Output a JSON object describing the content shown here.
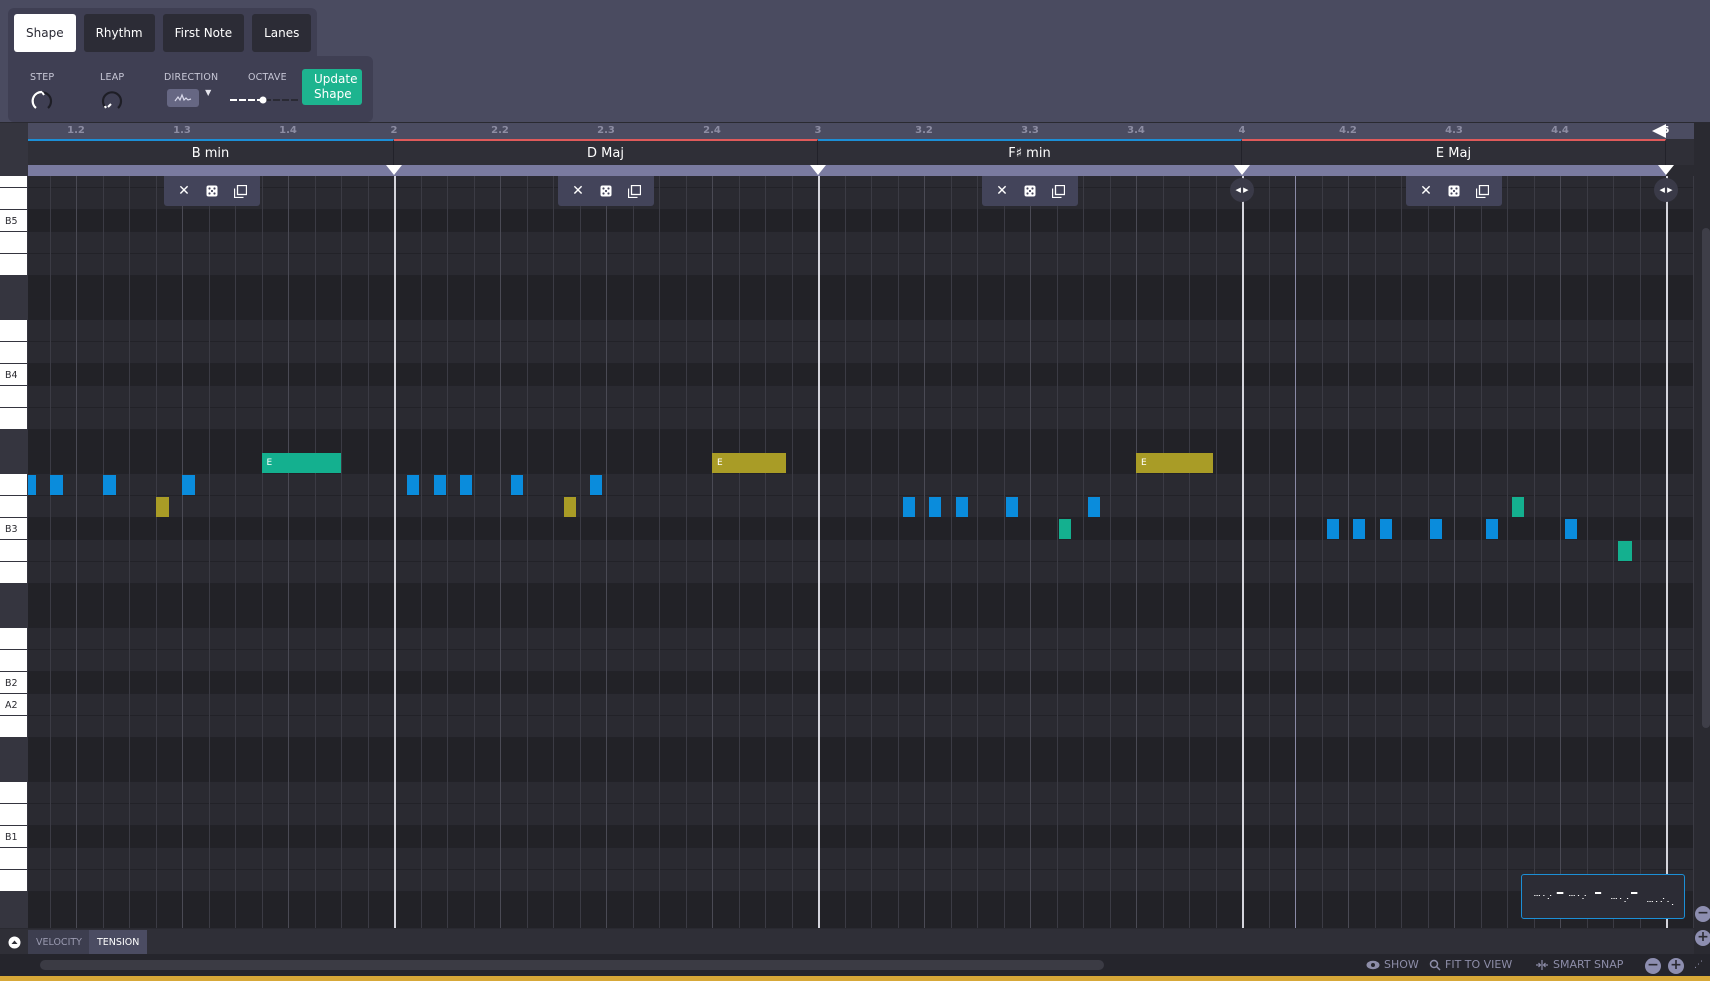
{
  "tabs": [
    {
      "label": "Shape",
      "active": true
    },
    {
      "label": "Rhythm",
      "active": false
    },
    {
      "label": "First Note",
      "active": false
    },
    {
      "label": "Lanes",
      "active": false
    }
  ],
  "controls": {
    "step_label": "STEP",
    "leap_label": "LEAP",
    "direction_label": "DIRECTION",
    "direction_icon": "zigzag-wave-icon",
    "octave_label": "OCTAVE",
    "octave_value_fraction": 0.55,
    "update_label_line1": "Update",
    "update_label_line2": "Shape"
  },
  "ruler": {
    "ticks": [
      "1.2",
      "1.3",
      "1.4",
      "2",
      "2.2",
      "2.3",
      "2.4",
      "3",
      "3.2",
      "3.3",
      "3.4",
      "4",
      "4.2",
      "4.3",
      "4.4",
      "5"
    ]
  },
  "chords": [
    {
      "name": "B min",
      "color": "#1c8fd6"
    },
    {
      "name": "D Maj",
      "color": "#e05a5a"
    },
    {
      "name": "F♯ min",
      "color": "#1c8fd6"
    },
    {
      "name": "E Maj",
      "color": "#e05a5a"
    }
  ],
  "chord_tools": {
    "remove_icon": "✕",
    "randomize_icon": "dice-icon",
    "duplicate_icon": "copy-icon"
  },
  "piano_keys": {
    "labels": {
      "B5": 2,
      "B4": 9,
      "B3": 16,
      "B2": 23,
      "A2": 24,
      "B1": 30
    }
  },
  "notes": [
    {
      "bar": 1,
      "start16": 1,
      "len16": 0.5,
      "row": 14,
      "color": "#0a8cdc"
    },
    {
      "bar": 1,
      "start16": 2,
      "len16": 0.5,
      "row": 14,
      "color": "#0a8cdc"
    },
    {
      "bar": 1,
      "start16": 3,
      "len16": 0.5,
      "row": 14,
      "color": "#0a8cdc"
    },
    {
      "bar": 1,
      "start16": 5,
      "len16": 0.5,
      "row": 14,
      "color": "#0a8cdc"
    },
    {
      "bar": 1,
      "start16": 7,
      "len16": 0.5,
      "row": 15,
      "color": "#a99c26"
    },
    {
      "bar": 1,
      "start16": 8,
      "len16": 0.5,
      "row": 14,
      "color": "#0a8cdc"
    },
    {
      "bar": 1,
      "start16": 11,
      "len16": 3,
      "row": 13,
      "color": "#14b08f",
      "label": "E"
    },
    {
      "bar": 2,
      "start16": 0.5,
      "len16": 0.3,
      "row": 14,
      "color": "#0a8cdc"
    },
    {
      "bar": 2,
      "start16": 1.5,
      "len16": 0.3,
      "row": 14,
      "color": "#0a8cdc"
    },
    {
      "bar": 2,
      "start16": 2.5,
      "len16": 0.3,
      "row": 14,
      "color": "#0a8cdc"
    },
    {
      "bar": 2,
      "start16": 4.4,
      "len16": 0.3,
      "row": 14,
      "color": "#0a8cdc"
    },
    {
      "bar": 2,
      "start16": 6.4,
      "len16": 0.3,
      "row": 15,
      "color": "#a99c26"
    },
    {
      "bar": 2,
      "start16": 7.4,
      "len16": 0.3,
      "row": 14,
      "color": "#0a8cdc"
    },
    {
      "bar": 2,
      "start16": 12,
      "len16": 2.8,
      "row": 13,
      "color": "#a99c26",
      "label": "E"
    },
    {
      "bar": 3,
      "start16": 3.2,
      "len16": 0.3,
      "row": 15,
      "color": "#0a8cdc"
    },
    {
      "bar": 3,
      "start16": 4.2,
      "len16": 0.3,
      "row": 15,
      "color": "#0a8cdc"
    },
    {
      "bar": 3,
      "start16": 5.2,
      "len16": 0.3,
      "row": 15,
      "color": "#0a8cdc"
    },
    {
      "bar": 3,
      "start16": 7.1,
      "len16": 0.3,
      "row": 15,
      "color": "#0a8cdc"
    },
    {
      "bar": 3,
      "start16": 9.1,
      "len16": 0.3,
      "row": 16,
      "color": "#14b08f"
    },
    {
      "bar": 3,
      "start16": 10.2,
      "len16": 0.3,
      "row": 15,
      "color": "#0a8cdc"
    },
    {
      "bar": 3,
      "start16": 12,
      "len16": 2.9,
      "row": 13,
      "color": "#a99c26",
      "label": "E"
    },
    {
      "bar": 4,
      "start16": 3.2,
      "len16": 0.3,
      "row": 16,
      "color": "#0a8cdc"
    },
    {
      "bar": 4,
      "start16": 4.2,
      "len16": 0.3,
      "row": 16,
      "color": "#0a8cdc"
    },
    {
      "bar": 4,
      "start16": 5.2,
      "len16": 0.3,
      "row": 16,
      "color": "#0a8cdc"
    },
    {
      "bar": 4,
      "start16": 7.1,
      "len16": 0.3,
      "row": 16,
      "color": "#0a8cdc"
    },
    {
      "bar": 4,
      "start16": 9.2,
      "len16": 0.3,
      "row": 16,
      "color": "#0a8cdc"
    },
    {
      "bar": 4,
      "start16": 10.2,
      "len16": 0.3,
      "row": 15,
      "color": "#14b08f"
    },
    {
      "bar": 4,
      "start16": 12.2,
      "len16": 0.3,
      "row": 16,
      "color": "#0a8cdc"
    },
    {
      "bar": 4,
      "start16": 14.2,
      "len16": 0.5,
      "row": 17,
      "color": "#14b08f"
    }
  ],
  "lanes": {
    "tabs": [
      {
        "label": "VELOCITY",
        "active": false
      },
      {
        "label": "TENSION",
        "active": true
      }
    ]
  },
  "footer": {
    "show_label": "SHOW",
    "fit_label": "FIT TO VIEW",
    "snap_label": "SMART SNAP"
  }
}
